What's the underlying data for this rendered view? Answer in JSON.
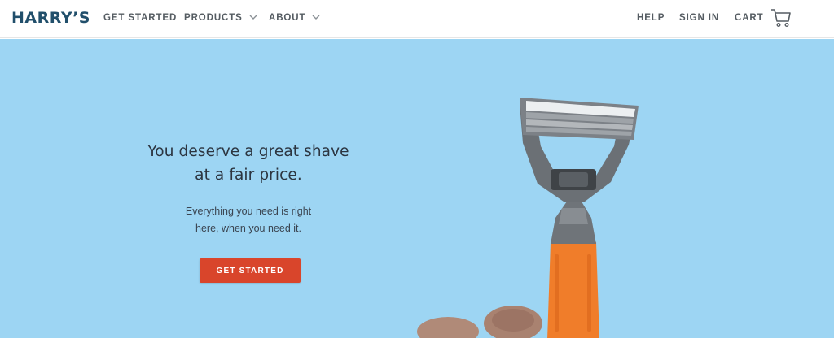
{
  "nav": {
    "logo": "HARRY’S",
    "get_started": "GET STARTED",
    "products": "PRODUCTS",
    "about": "ABOUT",
    "help": "HELP",
    "sign_in": "SIGN IN",
    "cart": "CART"
  },
  "hero": {
    "headline_line1": "You deserve a great shave",
    "headline_line2": "at a fair price.",
    "sub_line1": "Everything you need is right",
    "sub_line2": "here, when you need it.",
    "cta": "GET STARTED"
  },
  "colors": {
    "brand_navy": "#214f6b",
    "hero_background": "#9dd5f3",
    "cta": "#d9452b",
    "razor_handle": "#f07d2a"
  },
  "icons": [
    "chevron-down-icon",
    "cart-icon"
  ]
}
